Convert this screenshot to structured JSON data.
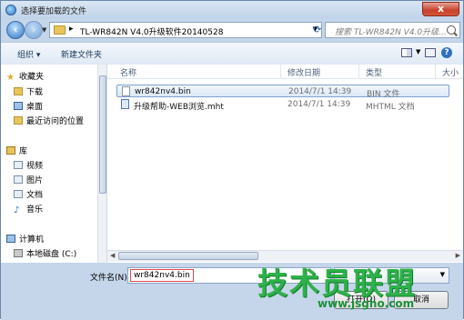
{
  "window": {
    "title": "选择要加载的文件",
    "close_symbol": "x"
  },
  "address": {
    "path": "TL-WR842N V4.0升级软件20140528",
    "separator": "▸",
    "search_placeholder": "搜索 TL-WR842N V4.0升级..."
  },
  "toolbar": {
    "organize": "组织 ▾",
    "new_folder": "新建文件夹",
    "help": "?"
  },
  "sidebar": {
    "items": [
      {
        "label": "收藏夹",
        "icon": "star-icon"
      },
      {
        "label": "下载",
        "icon": "download-folder-icon"
      },
      {
        "label": "桌面",
        "icon": "desktop-icon"
      },
      {
        "label": "最近访问的位置",
        "icon": "recent-places-icon"
      },
      {
        "label": "库",
        "icon": "library-icon"
      },
      {
        "label": "视频",
        "icon": "video-icon"
      },
      {
        "label": "图片",
        "icon": "pictures-icon"
      },
      {
        "label": "文档",
        "icon": "documents-icon"
      },
      {
        "label": "音乐",
        "icon": "music-icon"
      },
      {
        "label": "计算机",
        "icon": "computer-icon"
      },
      {
        "label": "本地磁盘 (C:)",
        "icon": "drive-icon"
      }
    ]
  },
  "columns": {
    "name": "名称",
    "date": "修改日期",
    "type": "类型",
    "size": "大小"
  },
  "files": [
    {
      "name": "wr842nv4.bin",
      "date": "2014/7/1 14:39",
      "type": "BIN 文件"
    },
    {
      "name": "升级帮助-WEB浏览.mht",
      "date": "2014/7/1 14:39",
      "type": "MHTML 文档"
    }
  ],
  "footer": {
    "filename_label": "文件名(N):",
    "filename_value": "wr842nv4.bin",
    "open_label": "打开(O)",
    "cancel_label": "取消"
  },
  "watermark": {
    "text": "技术员联盟",
    "url": "www.jsgho.com"
  }
}
